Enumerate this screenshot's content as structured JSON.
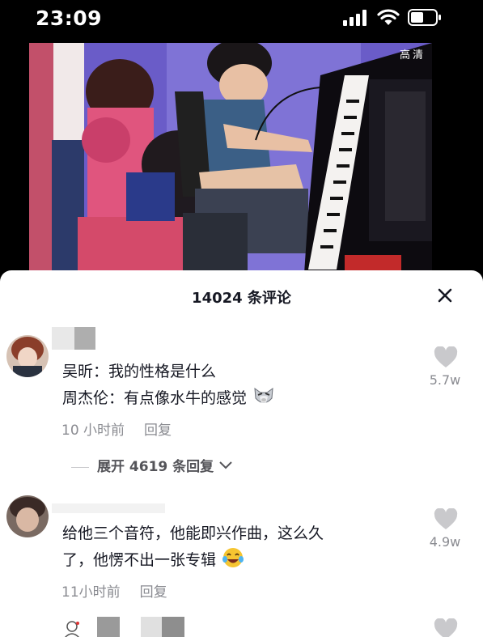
{
  "status_bar": {
    "time": "23:09"
  },
  "video": {
    "quality_label": "高清",
    "scene_description_icon": "piano-performance-scene"
  },
  "comments_panel": {
    "title": "14024 条评论",
    "close_icon": "close-icon",
    "comments": [
      {
        "line1": "吴昕：我的性格是什么",
        "line2": "周杰伦：有点像水牛的感觉",
        "emoji": "dog-face-emoji",
        "time": "10 小时前",
        "reply": "回复",
        "likes": "5.7w",
        "expand_replies": "展开 4619 条回复"
      },
      {
        "line1": "给他三个音符，他能即兴作曲，这么久",
        "line2": "了，他愣不出一张专辑",
        "emoji": "crying-laughing-emoji",
        "time": "11小时前",
        "reply": "回复",
        "likes": "4.9w"
      }
    ]
  },
  "colors": {
    "sheet_bg": "#ffffff",
    "primary_text": "#161823",
    "secondary_text": "#8a8b91",
    "like_icon": "#c9c9cc"
  }
}
